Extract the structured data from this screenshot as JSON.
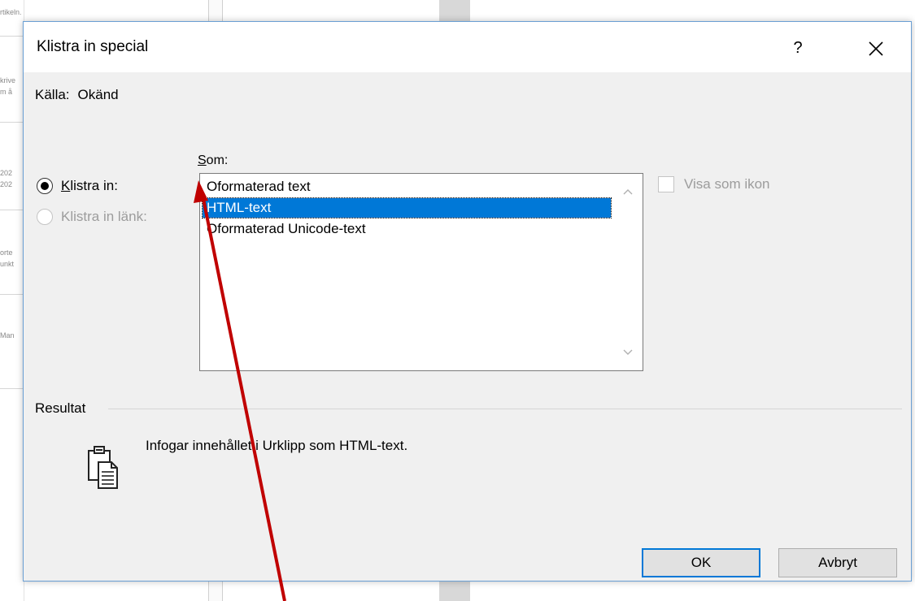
{
  "background": {
    "snippets": [
      "rtikeln.",
      "krive",
      "m å",
      "202",
      "202",
      "orte",
      "unkt",
      "Man"
    ]
  },
  "dialog": {
    "title": "Klistra in special",
    "help_label": "?",
    "source_label": "Källa:",
    "source_value": "Okänd",
    "as_label_accel": "S",
    "as_label_rest": "om:",
    "paste_accel": "K",
    "paste_label_rest": "listra in:",
    "paste_link_label": "Klistra in länk:",
    "formats": [
      {
        "label": "Oformaterad text",
        "selected": false
      },
      {
        "label": "HTML-text",
        "selected": true
      },
      {
        "label": "Oformaterad Unicode-text",
        "selected": false
      }
    ],
    "show_as_icon_label": "Visa som ikon",
    "result_label": "Resultat",
    "result_text": "Infogar innehållet i Urklipp som HTML-text.",
    "ok_label": "OK",
    "cancel_label": "Avbryt"
  },
  "colors": {
    "selection": "#0078d7",
    "arrow": "#c00000",
    "dialog_border": "#6a9fd4"
  }
}
